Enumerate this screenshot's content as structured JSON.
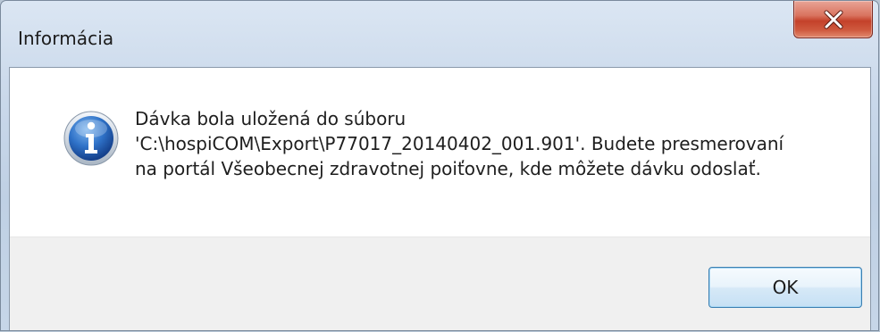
{
  "window": {
    "title": "Informácia"
  },
  "dialog": {
    "icon": "information-icon",
    "message_lines": [
      "Dávka bola uložená do súboru",
      "'C:\\hospiCOM\\Export\\P77017_20140402_001.901'. Budete presmerovaní",
      "na portál Všeobecnej zdravotnej poiťovne, kde môžete dávku odoslať."
    ],
    "ok_label": "OK"
  },
  "colors": {
    "close_button": "#c4412a",
    "ok_border": "#3c7fb1",
    "info_icon": "#1d5fb0"
  }
}
